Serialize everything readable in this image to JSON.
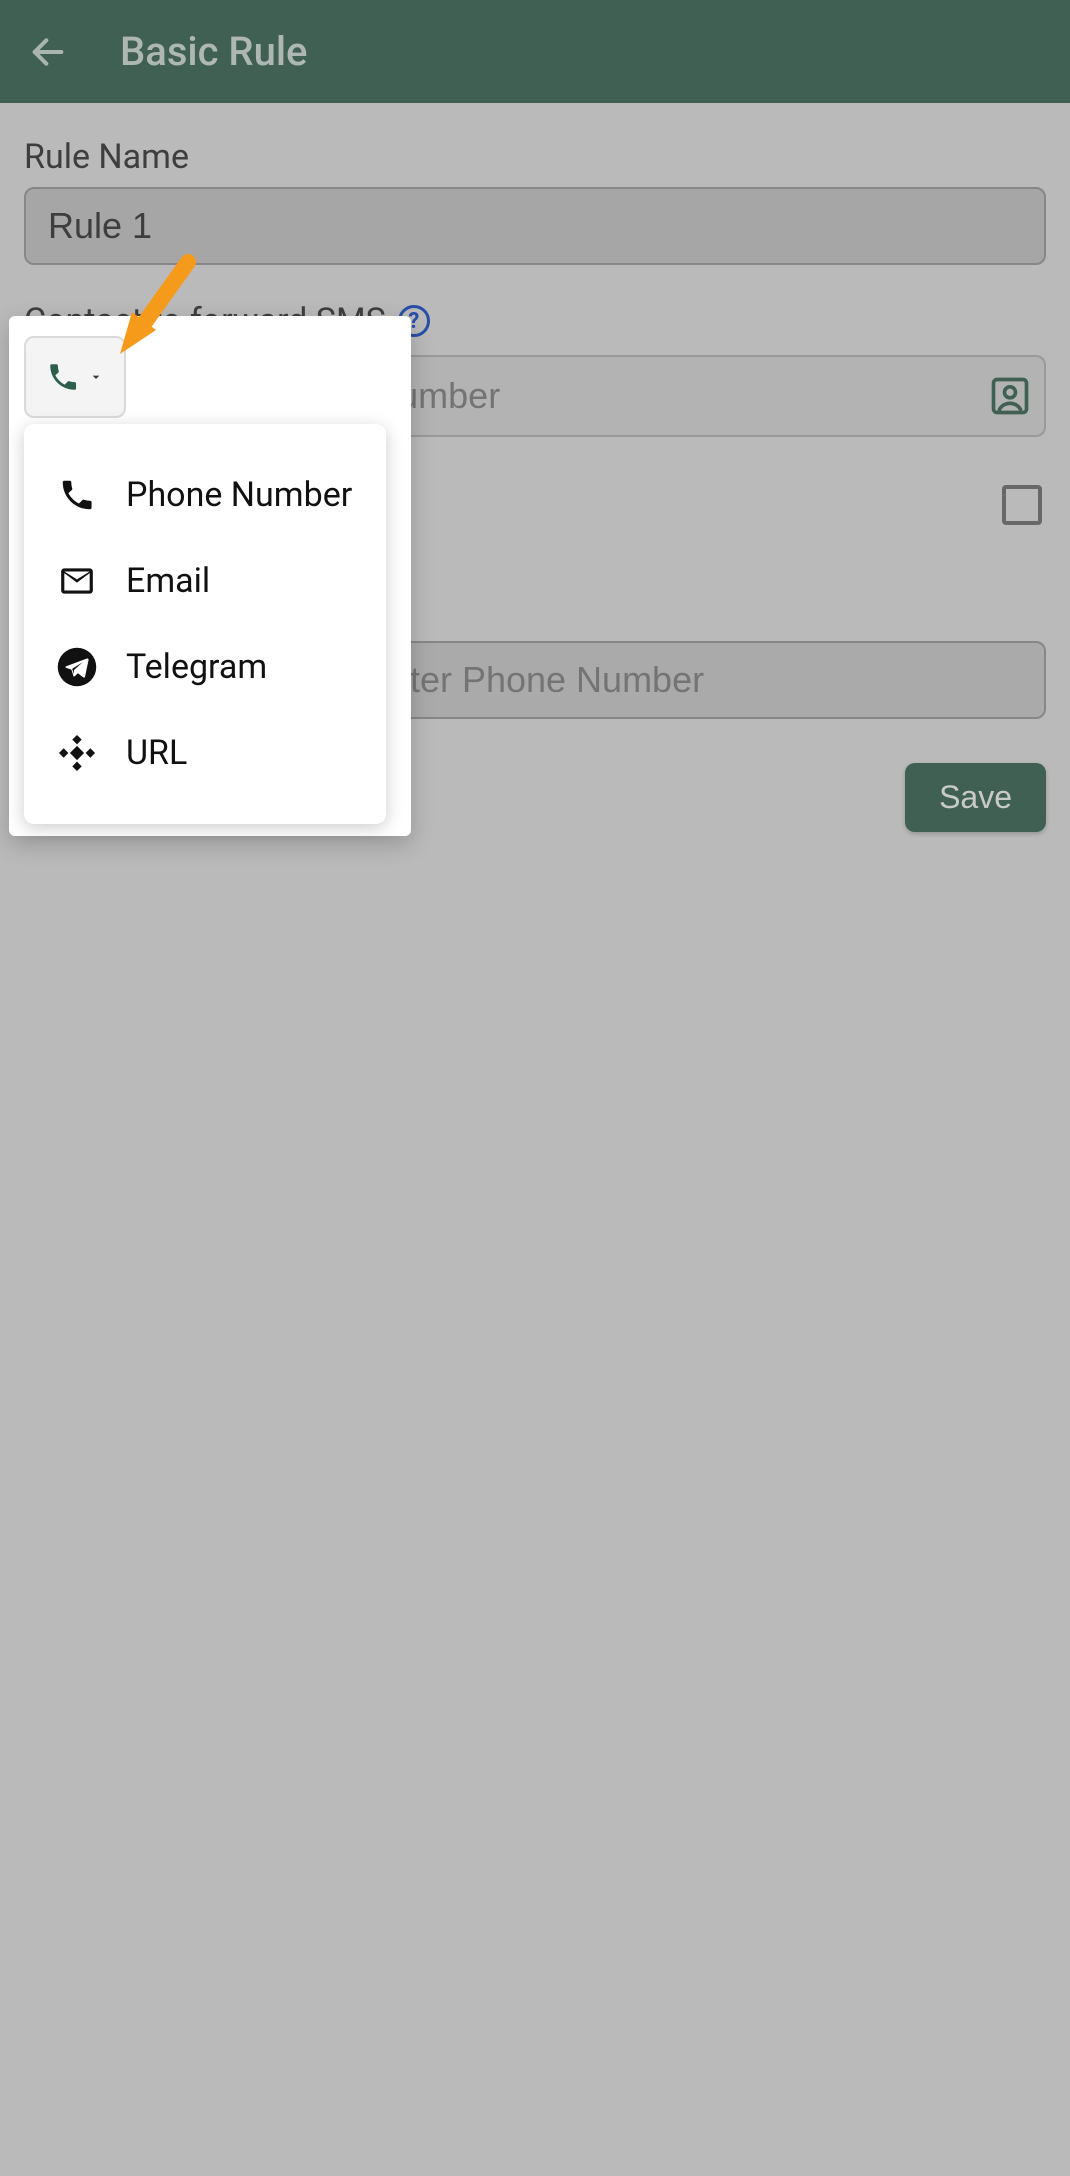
{
  "header": {
    "title": "Basic Rule"
  },
  "form": {
    "rule_name_label": "Rule Name",
    "rule_name_value": "Rule 1",
    "contact_label": "Contact to forward SMS",
    "phone_placeholder": "Enter Phone Number",
    "hidden_placeholder": "Enter Phone Number",
    "save_label": "Save"
  },
  "menu": {
    "items": [
      {
        "label": "Phone Number"
      },
      {
        "label": "Email"
      },
      {
        "label": "Telegram"
      },
      {
        "label": "URL"
      }
    ]
  }
}
